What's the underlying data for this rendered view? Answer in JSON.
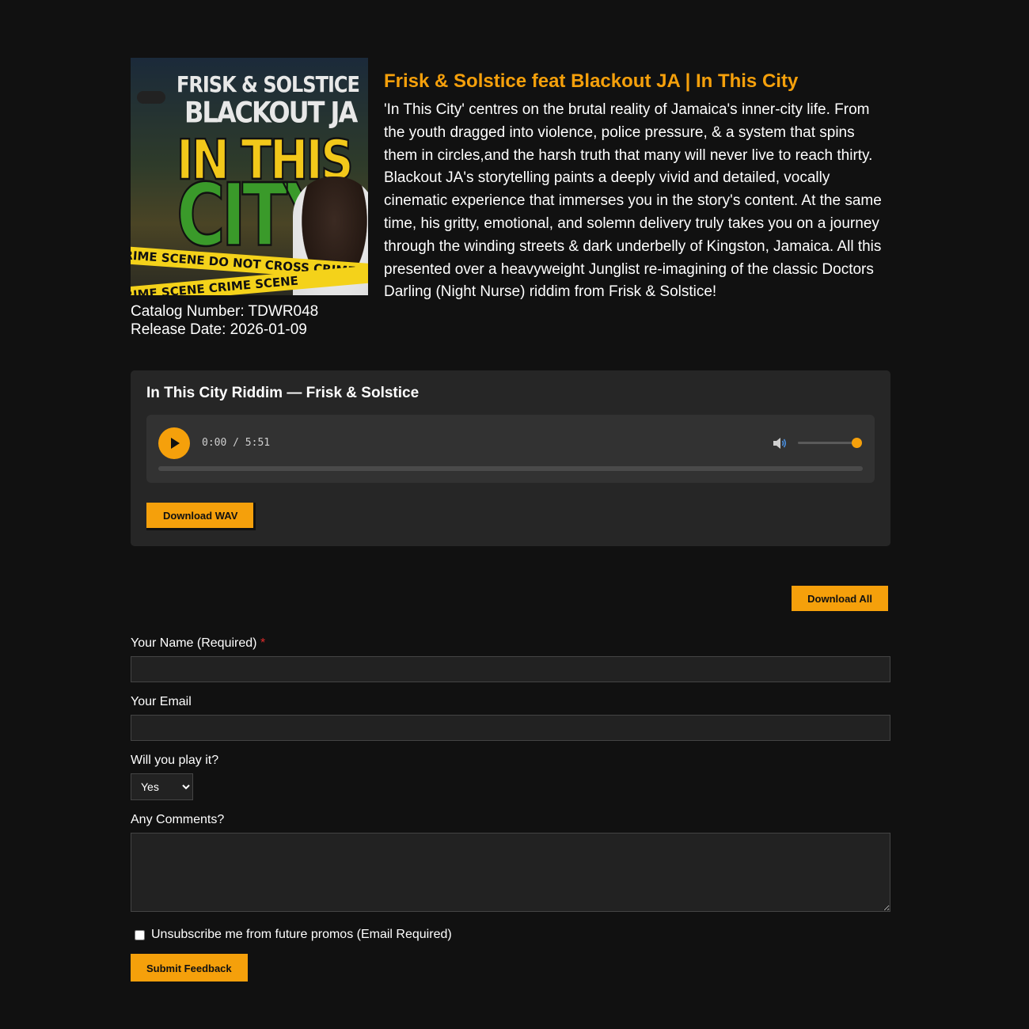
{
  "release": {
    "title": "Frisk & Solstice feat Blackout JA | In This City",
    "description": "'In This City' centres on the brutal reality of Jamaica's inner-city life. From the youth dragged into violence, police pressure, & a system that spins them in circles,and the harsh truth that many will never live to reach thirty. Blackout JA's storytelling paints a deeply vivid and detailed, vocally cinematic experience that immerses you in the story's content. At the same time, his gritty, emotional, and solemn delivery truly takes you on a journey through the winding streets & dark underbelly of Kingston, Jamaica. All this presented over a heavyweight Junglist re-imagining of the classic Doctors Darling (Night Nurse) riddim from Frisk & Solstice!",
    "catalog": "Catalog Number: TDWR048",
    "release_date": "Release Date: 2026-01-09",
    "cover": {
      "line1": "FRISK & SOLSTICE",
      "line2": "BLACKOUT JA",
      "line3": "IN THIS",
      "line4": "CITY",
      "tape_text": "CRIME SCENE DO NOT CROSS   CRIME SCENE",
      "tape_text_2": "CRIME SCENE   CRIME SCENE"
    }
  },
  "track": {
    "title": "In This City Riddim — Frisk & Solstice",
    "time": "0:00 / 5:51",
    "volume": 1.0,
    "progress": 0.0,
    "download_label": "Download WAV"
  },
  "download_all_label": "Download All",
  "form": {
    "name_label": "Your Name (Required)",
    "required_mark": "*",
    "email_label": "Your Email",
    "play_label": "Will you play it?",
    "play_selected": "Yes",
    "comments_label": "Any Comments?",
    "unsubscribe_label": "Unsubscribe me from future promos (Email Required)",
    "submit_label": "Submit Feedback"
  },
  "colors": {
    "accent": "#f5a00b",
    "background": "#111111",
    "card": "#262626"
  }
}
